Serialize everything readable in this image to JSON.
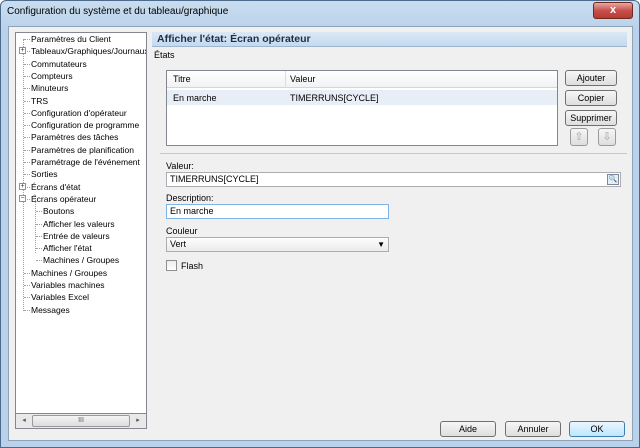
{
  "window": {
    "title": "Configuration du système et du tableau/graphique",
    "close": "x"
  },
  "tree": {
    "items": [
      {
        "label": "Paramètres du Client",
        "level": 0
      },
      {
        "label": "Tableaux/Graphiques/Journaux",
        "level": 0,
        "expander": "+"
      },
      {
        "label": "Commutateurs",
        "level": 0
      },
      {
        "label": "Compteurs",
        "level": 0
      },
      {
        "label": "Minuteurs",
        "level": 0
      },
      {
        "label": "TRS",
        "level": 0
      },
      {
        "label": "Configuration d'opérateur",
        "level": 0
      },
      {
        "label": "Configuration de programme",
        "level": 0
      },
      {
        "label": "Paramètres des tâches",
        "level": 0
      },
      {
        "label": "Paramètres de planification",
        "level": 0
      },
      {
        "label": "Paramétrage de l'événement",
        "level": 0
      },
      {
        "label": "Sorties",
        "level": 0
      },
      {
        "label": "Écrans d'état",
        "level": 0,
        "expander": "+"
      },
      {
        "label": "Écrans opérateur",
        "level": 0,
        "expander": "−"
      },
      {
        "label": "Boutons",
        "level": 1
      },
      {
        "label": "Afficher les valeurs",
        "level": 1
      },
      {
        "label": "Entrée de valeurs",
        "level": 1
      },
      {
        "label": "Afficher l'état",
        "level": 1
      },
      {
        "label": "Machines / Groupes",
        "level": 1
      },
      {
        "label": "Machines / Groupes",
        "level": 0
      },
      {
        "label": "Variables machines",
        "level": 0
      },
      {
        "label": "Variables Excel",
        "level": 0
      },
      {
        "label": "Messages",
        "level": 0
      }
    ],
    "scroll_left": "◂",
    "scroll_right": "▸",
    "scroll_grip": "III"
  },
  "panel": {
    "title": "Afficher l'état: Écran opérateur",
    "section_label": "États",
    "grid": {
      "columns": [
        "Titre",
        "Valeur"
      ],
      "rows": [
        {
          "titre": "En marche",
          "valeur": "TIMERRUNS[CYCLE]"
        }
      ]
    },
    "buttons": {
      "add": "Ajouter",
      "copy": "Copier",
      "delete": "Supprimer",
      "up": "⇧",
      "down": "⇩"
    },
    "value_label": "Valeur:",
    "value": "TIMERRUNS[CYCLE]",
    "picker_icon": "🔍",
    "description_label": "Description:",
    "description": "En marche",
    "color_label": "Couleur",
    "color_value": "Vert",
    "select_arrow": "▼",
    "flash_label": "Flash",
    "flash_checked": false
  },
  "footer": {
    "help": "Aide",
    "cancel": "Annuler",
    "ok": "OK"
  }
}
